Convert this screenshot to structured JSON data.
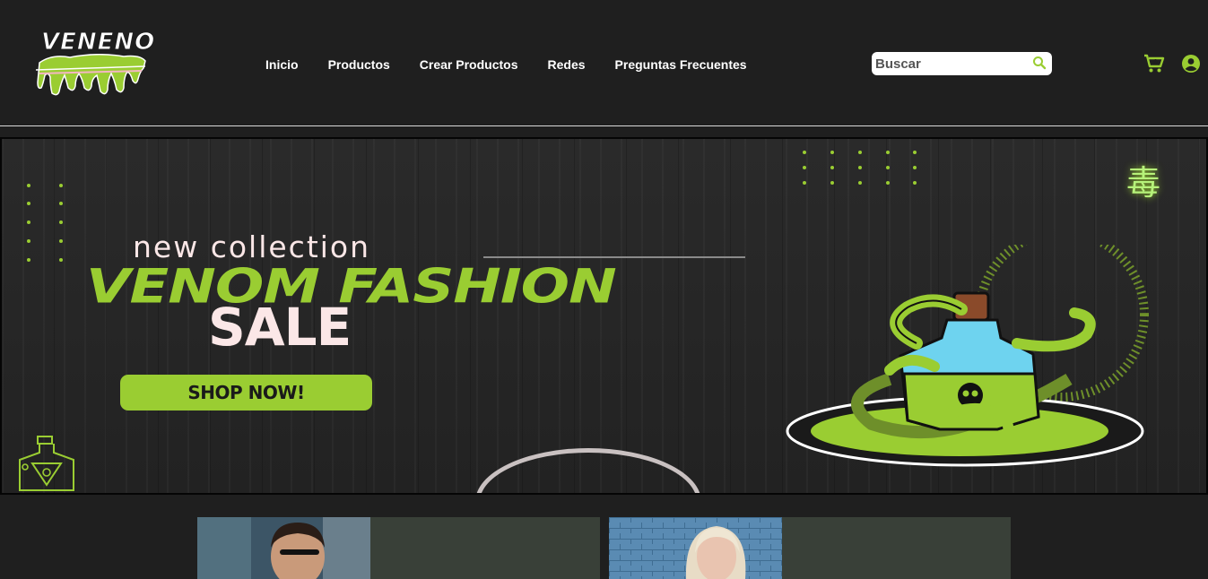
{
  "header": {
    "logo_text": "VENENO",
    "nav": [
      "Inicio",
      "Productos",
      "Crear Productos",
      "Redes",
      "Preguntas Frecuentes"
    ],
    "search": {
      "placeholder": "Buscar",
      "value": ""
    },
    "icons": {
      "search": "search-icon",
      "cart": "add-to-cart-icon",
      "account": "account-circle-icon"
    }
  },
  "banner": {
    "eyebrow": "new collection",
    "headline": "VENOM FASHION",
    "subheadline": "SALE",
    "cta": "SHOP NOW!",
    "kanji": "毒"
  },
  "colors": {
    "accent": "#9acd32",
    "background": "#1f1f1f",
    "text": "#ffffff",
    "cream": "#fbe7e7",
    "card": "#394038"
  }
}
